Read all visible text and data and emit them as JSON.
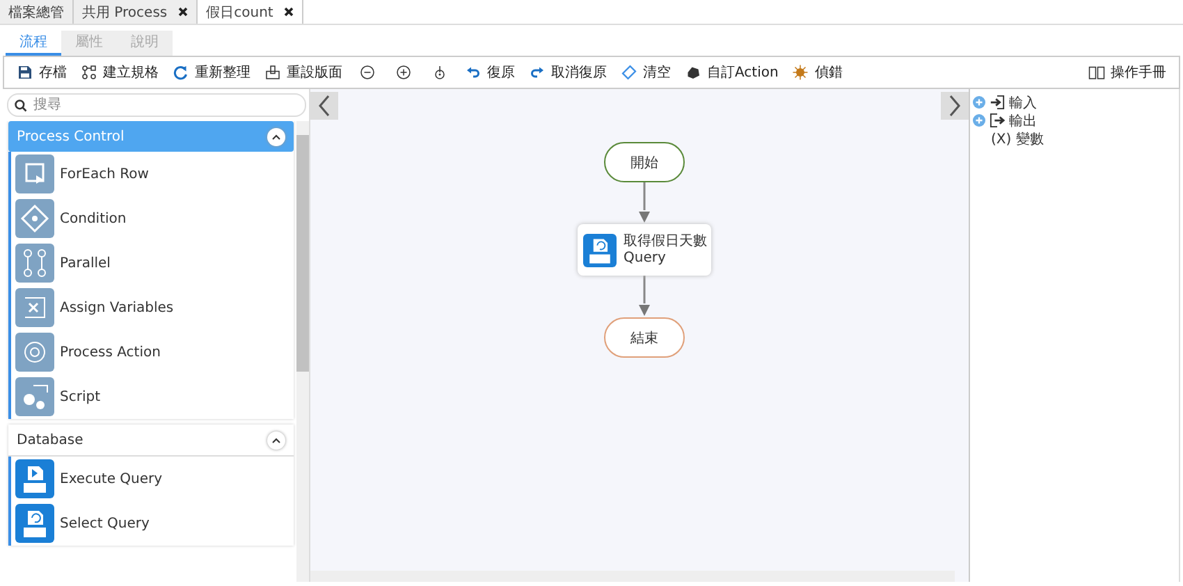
{
  "document_tabs": [
    {
      "label": "檔案總管",
      "closable": false,
      "selected": false
    },
    {
      "label": "共用 Process",
      "closable": true,
      "selected": false
    },
    {
      "label": "假日count",
      "closable": true,
      "selected": true
    }
  ],
  "view_tabs": [
    {
      "label": "流程",
      "selected": true
    },
    {
      "label": "屬性",
      "selected": false
    },
    {
      "label": "說明",
      "selected": false
    }
  ],
  "toolbar": {
    "items": [
      {
        "kind": "save",
        "label": "存檔"
      },
      {
        "kind": "spec",
        "label": "建立規格"
      },
      {
        "kind": "refresh",
        "label": "重新整理"
      },
      {
        "kind": "reset-layout",
        "label": "重設版面"
      },
      {
        "kind": "zoom-out"
      },
      {
        "kind": "zoom-in"
      },
      {
        "kind": "zoom-reset"
      },
      {
        "kind": "undo",
        "label": "復原"
      },
      {
        "kind": "redo",
        "label": "取消復原"
      },
      {
        "kind": "clear",
        "label": "清空"
      },
      {
        "kind": "custom",
        "label": "自訂Action"
      },
      {
        "kind": "debug",
        "label": "偵錯"
      }
    ],
    "help": "操作手冊"
  },
  "palette": {
    "search": {
      "placeholder": "搜尋"
    },
    "groups": [
      {
        "title": "Process Control",
        "selected": true,
        "expanded": true,
        "items": [
          {
            "kind": "foreach",
            "label": "ForEach Row"
          },
          {
            "kind": "condition",
            "label": "Condition"
          },
          {
            "kind": "parallel",
            "label": "Parallel"
          },
          {
            "kind": "assign",
            "label": "Assign Variables"
          },
          {
            "kind": "action",
            "label": "Process Action"
          },
          {
            "kind": "script",
            "label": "Script"
          }
        ]
      },
      {
        "title": "Database",
        "selected": false,
        "expanded": true,
        "items": [
          {
            "kind": "execute-query",
            "label": "Execute Query"
          },
          {
            "kind": "select-query",
            "label": "Select Query"
          }
        ]
      }
    ]
  },
  "canvas": {
    "nodes": [
      {
        "kind": "start",
        "label": "開始"
      },
      {
        "kind": "task",
        "label": "取得假日天數",
        "subtitle": "Query"
      },
      {
        "kind": "end",
        "label": "結束"
      }
    ]
  },
  "properties": [
    {
      "kind": "input",
      "label": "輸入"
    },
    {
      "kind": "output",
      "label": "輸出"
    },
    {
      "kind": "variables",
      "label": "(X) 變數"
    }
  ]
}
